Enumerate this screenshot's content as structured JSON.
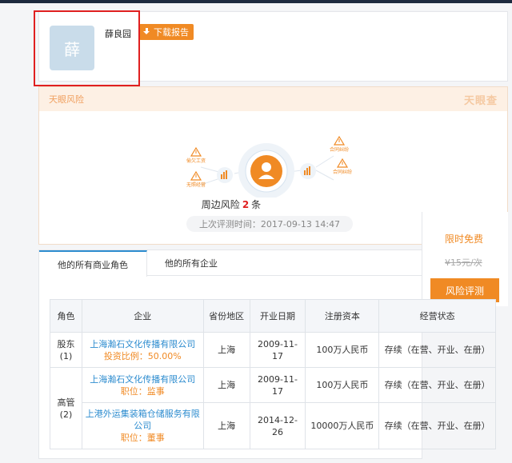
{
  "profile": {
    "avatar_char": "薛",
    "name": "薛良园",
    "download_label": "下载报告"
  },
  "risk": {
    "title": "天眼风险",
    "logo_text": "天眼查",
    "nodes": {
      "left_top": "偷欠工资",
      "left_bottom": "无照经营",
      "right_top": "合同纠纷",
      "right_bottom": "合同纠纷"
    },
    "count_prefix": "周边风险",
    "count": "2",
    "count_suffix": "条",
    "eval_time": "上次评测时间：2017-09-13 14:47"
  },
  "promo": {
    "free_label": "限时免费",
    "old_price": "¥15元/次",
    "button_label": "风险评测"
  },
  "tabs": [
    {
      "label": "他的所有商业角色",
      "active": true
    },
    {
      "label": "他的所有企业",
      "active": false
    }
  ],
  "table": {
    "headers": [
      "角色",
      "企业",
      "省份地区",
      "开业日期",
      "注册资本",
      "经营状态"
    ],
    "groups": [
      {
        "role": "股东(1)",
        "rows": [
          {
            "company": "上海瀚石文化传播有限公司",
            "sub": "投资比例：50.00%",
            "province": "上海",
            "date": "2009-11-17",
            "capital": "100万人民币",
            "status": "存续（在营、开业、在册）"
          }
        ]
      },
      {
        "role": "高管(2)",
        "rows": [
          {
            "company": "上海瀚石文化传播有限公司",
            "sub": "职位：监事",
            "province": "上海",
            "date": "2009-11-17",
            "capital": "100万人民币",
            "status": "存续（在营、开业、在册）"
          },
          {
            "company": "上港外运集装箱仓储服务有限公司",
            "sub": "职位：董事",
            "province": "上海",
            "date": "2014-12-26",
            "capital": "10000万人民币",
            "status": "存续（在营、开业、在册）"
          }
        ]
      }
    ]
  },
  "colors": {
    "accent_orange": "#f08a24",
    "link_blue": "#2d8ccf",
    "highlight_red": "#e02020"
  }
}
